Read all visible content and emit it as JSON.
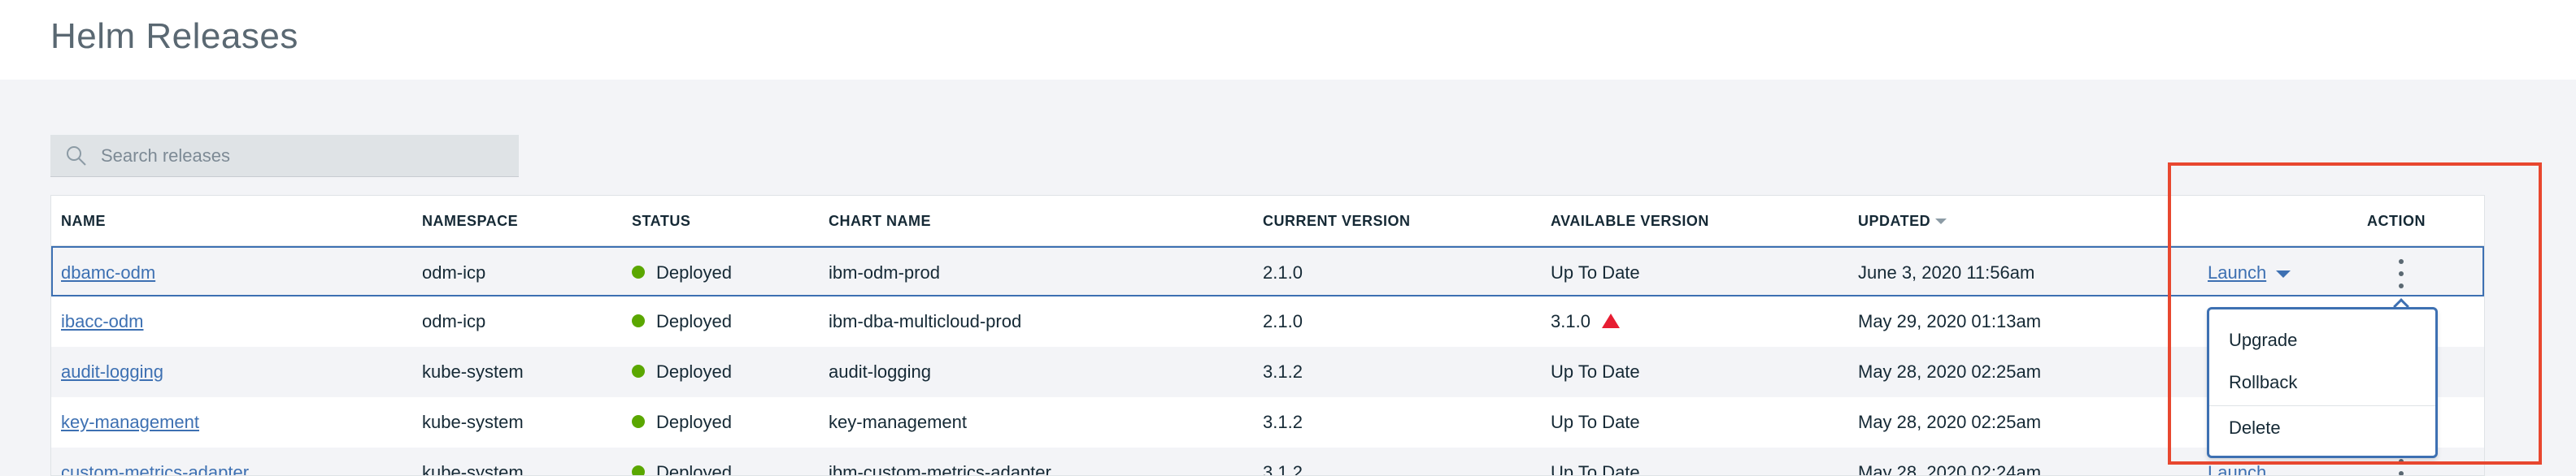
{
  "page": {
    "title": "Helm Releases"
  },
  "search": {
    "placeholder": "Search releases",
    "icon": "search-icon"
  },
  "table": {
    "columns": [
      {
        "key": "name",
        "label": "NAME"
      },
      {
        "key": "namespace",
        "label": "NAMESPACE"
      },
      {
        "key": "status",
        "label": "STATUS"
      },
      {
        "key": "chart",
        "label": "CHART NAME"
      },
      {
        "key": "current",
        "label": "CURRENT VERSION"
      },
      {
        "key": "available",
        "label": "AVAILABLE VERSION"
      },
      {
        "key": "updated",
        "label": "UPDATED",
        "sorted": "descending"
      },
      {
        "key": "action",
        "label": "ACTION"
      }
    ],
    "rows": [
      {
        "name": "dbamc-odm",
        "namespace": "odm-icp",
        "status": "Deployed",
        "chart": "ibm-odm-prod",
        "current": "2.1.0",
        "available": "Up To Date",
        "updated": "June 3, 2020 11:56am",
        "launch": "Launch",
        "upgrade_warning": false
      },
      {
        "name": "ibacc-odm",
        "namespace": "odm-icp",
        "status": "Deployed",
        "chart": "ibm-dba-multicloud-prod",
        "current": "2.1.0",
        "available": "3.1.0",
        "updated": "May 29, 2020 01:13am",
        "launch": "",
        "upgrade_warning": true
      },
      {
        "name": "audit-logging",
        "namespace": "kube-system",
        "status": "Deployed",
        "chart": "audit-logging",
        "current": "3.1.2",
        "available": "Up To Date",
        "updated": "May 28, 2020 02:25am",
        "launch": "",
        "upgrade_warning": false
      },
      {
        "name": "key-management",
        "namespace": "kube-system",
        "status": "Deployed",
        "chart": "key-management",
        "current": "3.1.2",
        "available": "Up To Date",
        "updated": "May 28, 2020 02:25am",
        "launch": "",
        "upgrade_warning": false
      },
      {
        "name": "custom-metrics-adapter",
        "namespace": "kube-system",
        "status": "Deployed",
        "chart": "ibm-custom-metrics-adapter",
        "current": "3.1.2",
        "available": "Up To Date",
        "updated": "May 28, 2020 02:24am",
        "launch": "Launch",
        "upgrade_warning": false
      }
    ]
  },
  "action_menu": {
    "items": [
      "Upgrade",
      "Rollback",
      "Delete"
    ]
  },
  "colors": {
    "link": "#3d70b2",
    "status_deployed": "#5aa700",
    "warning": "#e71d32",
    "highlight": "#e8472f"
  }
}
